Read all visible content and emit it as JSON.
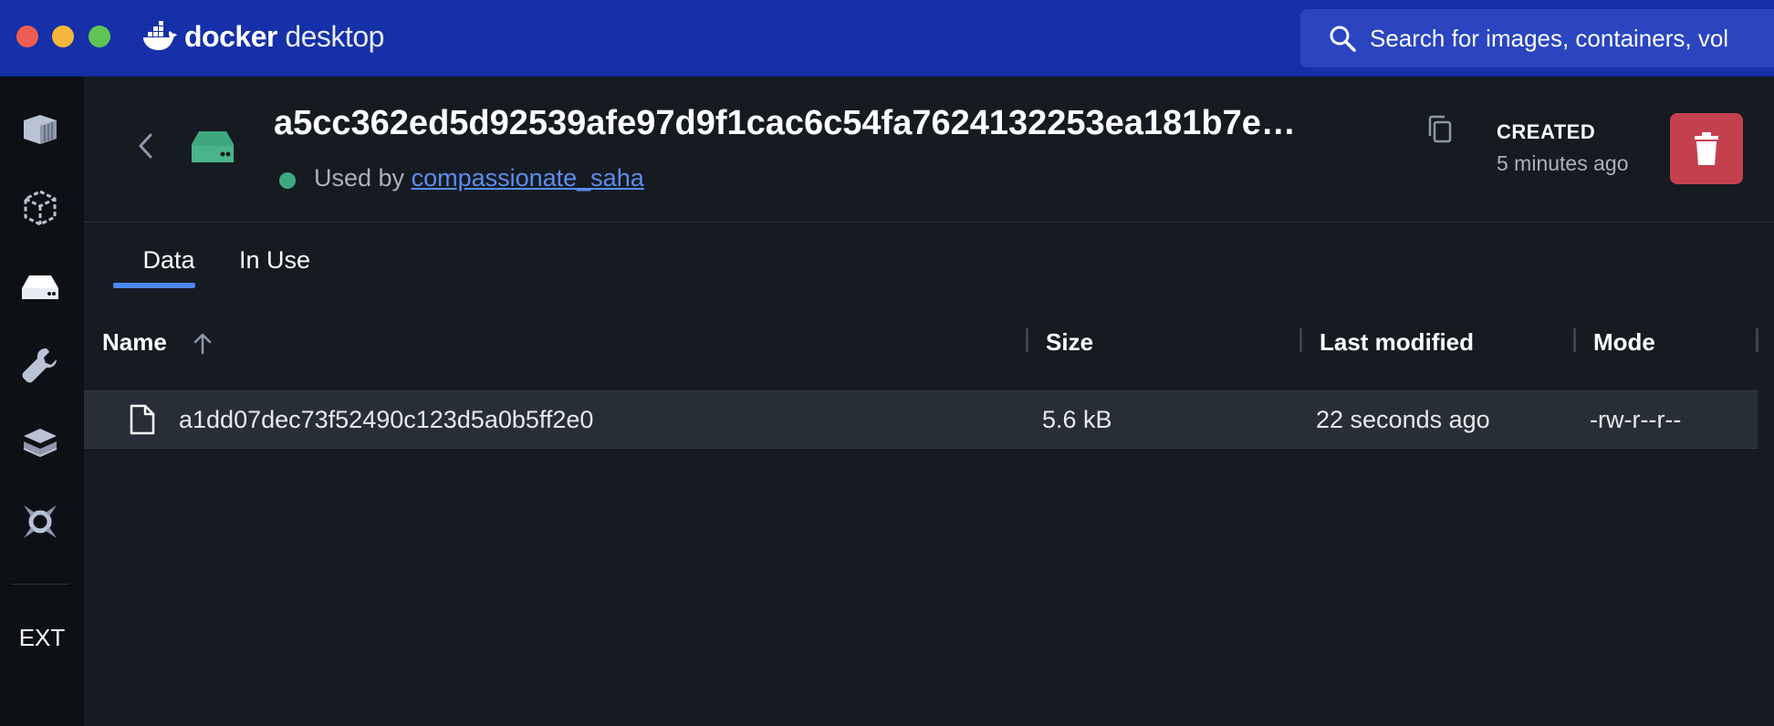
{
  "app": {
    "brand_bold": "docker",
    "brand_light": " desktop",
    "search_placeholder": "Search for images, containers, vol"
  },
  "sidebar": {
    "items": [
      {
        "name": "containers",
        "icon": "containers-icon"
      },
      {
        "name": "images",
        "icon": "images-icon"
      },
      {
        "name": "volumes",
        "icon": "volumes-icon",
        "active": true
      },
      {
        "name": "dev-environments",
        "icon": "wrench-icon"
      },
      {
        "name": "learning",
        "icon": "stack-icon"
      },
      {
        "name": "scout",
        "icon": "scout-icon"
      }
    ],
    "ext_label": "EXT"
  },
  "volume": {
    "title": "a5cc362ed5d92539afe97d9f1cac6c54fa7624132253ea181b7e…",
    "used_by_prefix": "Used by ",
    "used_by_link": "compassionate_saha",
    "status_color": "#3fa780",
    "created_label": "CREATED",
    "created_value": "5 minutes ago"
  },
  "tabs": [
    {
      "label": "Data",
      "active": true
    },
    {
      "label": "In Use",
      "active": false
    }
  ],
  "table": {
    "columns": [
      "Name",
      "Size",
      "Last modified",
      "Mode"
    ],
    "sort_column": "Name",
    "sort_direction": "ascending",
    "rows": [
      {
        "name": "a1dd07dec73f52490c123d5a0b5ff2e0",
        "size": "5.6 kB",
        "last_modified": "22 seconds ago",
        "mode": "-rw-r--r--"
      }
    ]
  },
  "colors": {
    "titlebar": "#1530a8",
    "accent": "#4b86f0",
    "delete": "#c4404f",
    "volume_icon": "#3fa780"
  }
}
